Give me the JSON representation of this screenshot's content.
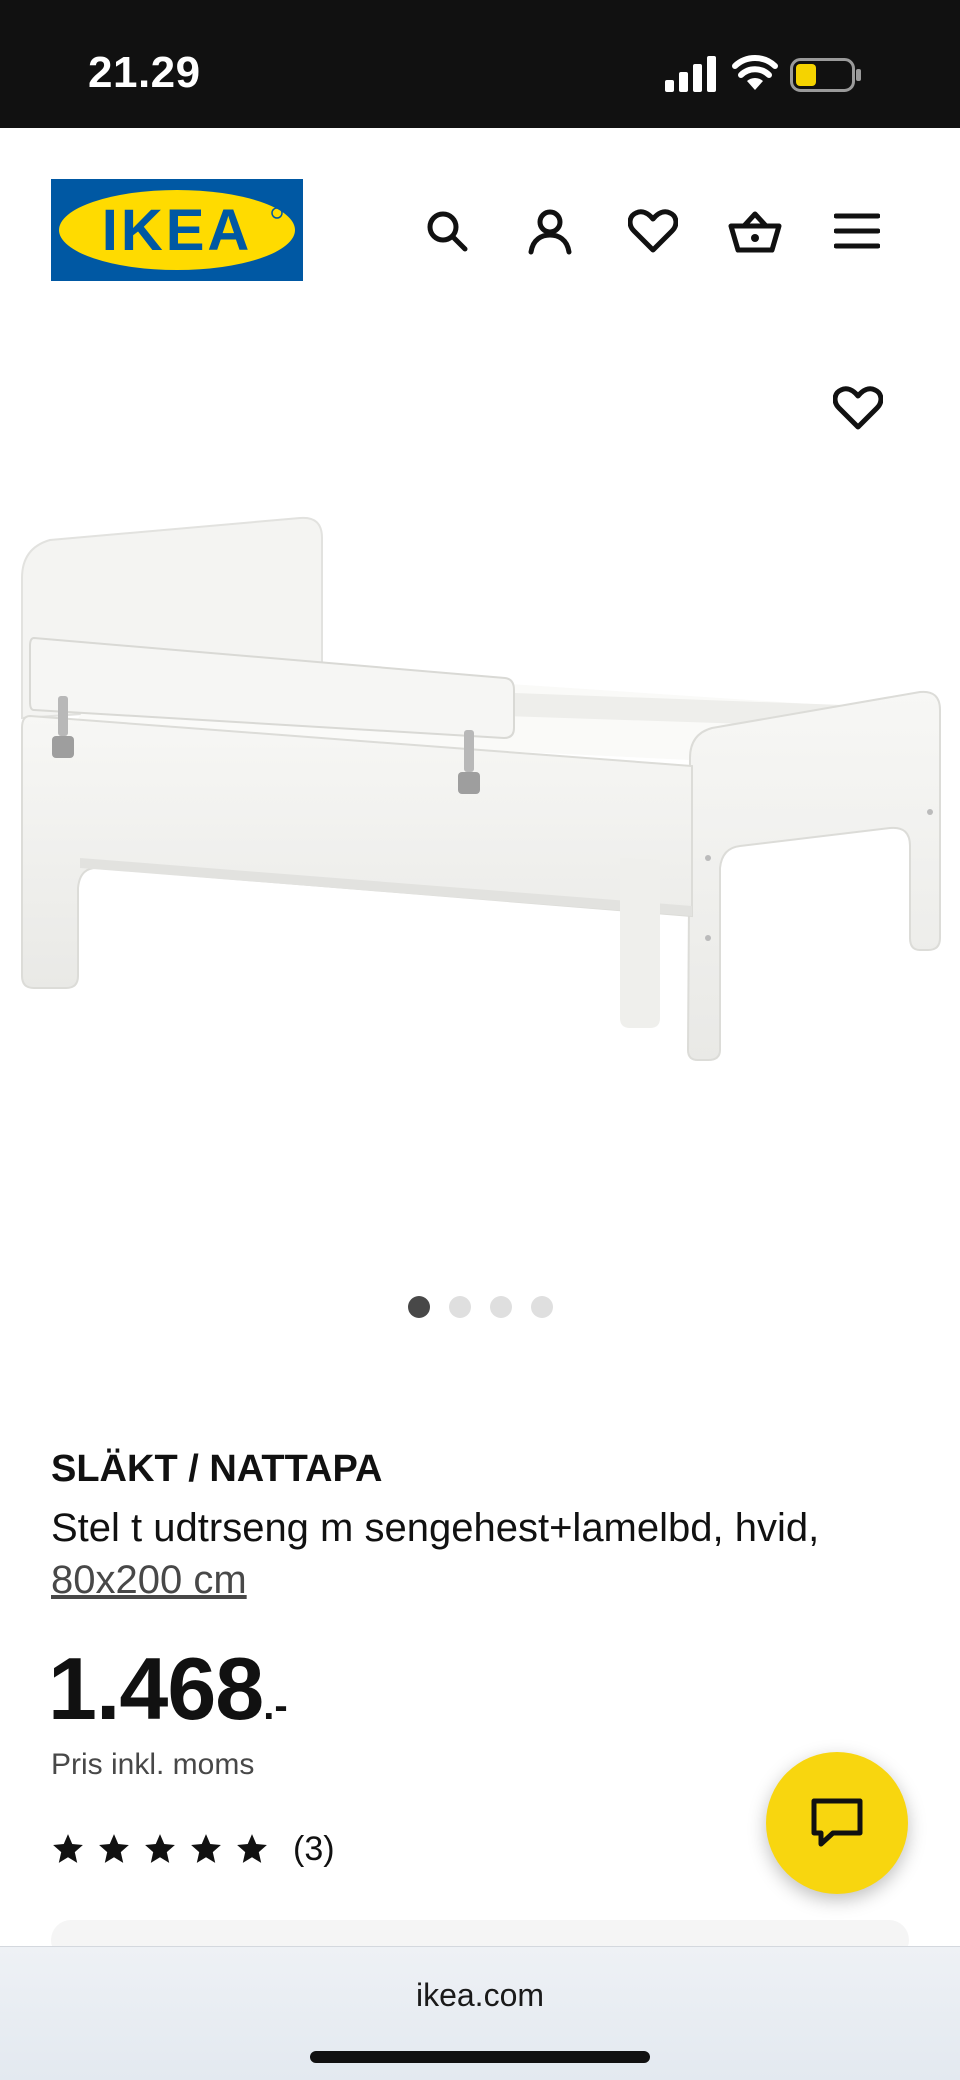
{
  "status_bar": {
    "time": "21.29",
    "icons": [
      "signal-icon",
      "wifi-icon",
      "battery-icon"
    ],
    "battery_color": "#f5d300"
  },
  "header": {
    "logo_text": "IKEA",
    "logo_colors": {
      "background": "#0058a3",
      "ellipse": "#ffdb00",
      "text": "#0058a3"
    },
    "actions": [
      "search-icon",
      "account-icon",
      "favorites-icon",
      "basket-icon",
      "menu-icon"
    ]
  },
  "gallery": {
    "favorite_icon": "heart-icon",
    "image_count": 4,
    "active_index": 0
  },
  "product": {
    "name": "SLÄKT / NATTAPA",
    "description": "Stel t udtrseng m sengehest+lamelbd, hvid,",
    "size": "80x200 cm",
    "price_main": "1.468",
    "price_suffix": ".-",
    "price_note": "Pris inkl. moms",
    "rating_stars": 5,
    "rating_count": "(3)"
  },
  "chat": {
    "icon": "chat-icon",
    "color": "#f8d60f"
  },
  "browser": {
    "url": "ikea.com"
  }
}
